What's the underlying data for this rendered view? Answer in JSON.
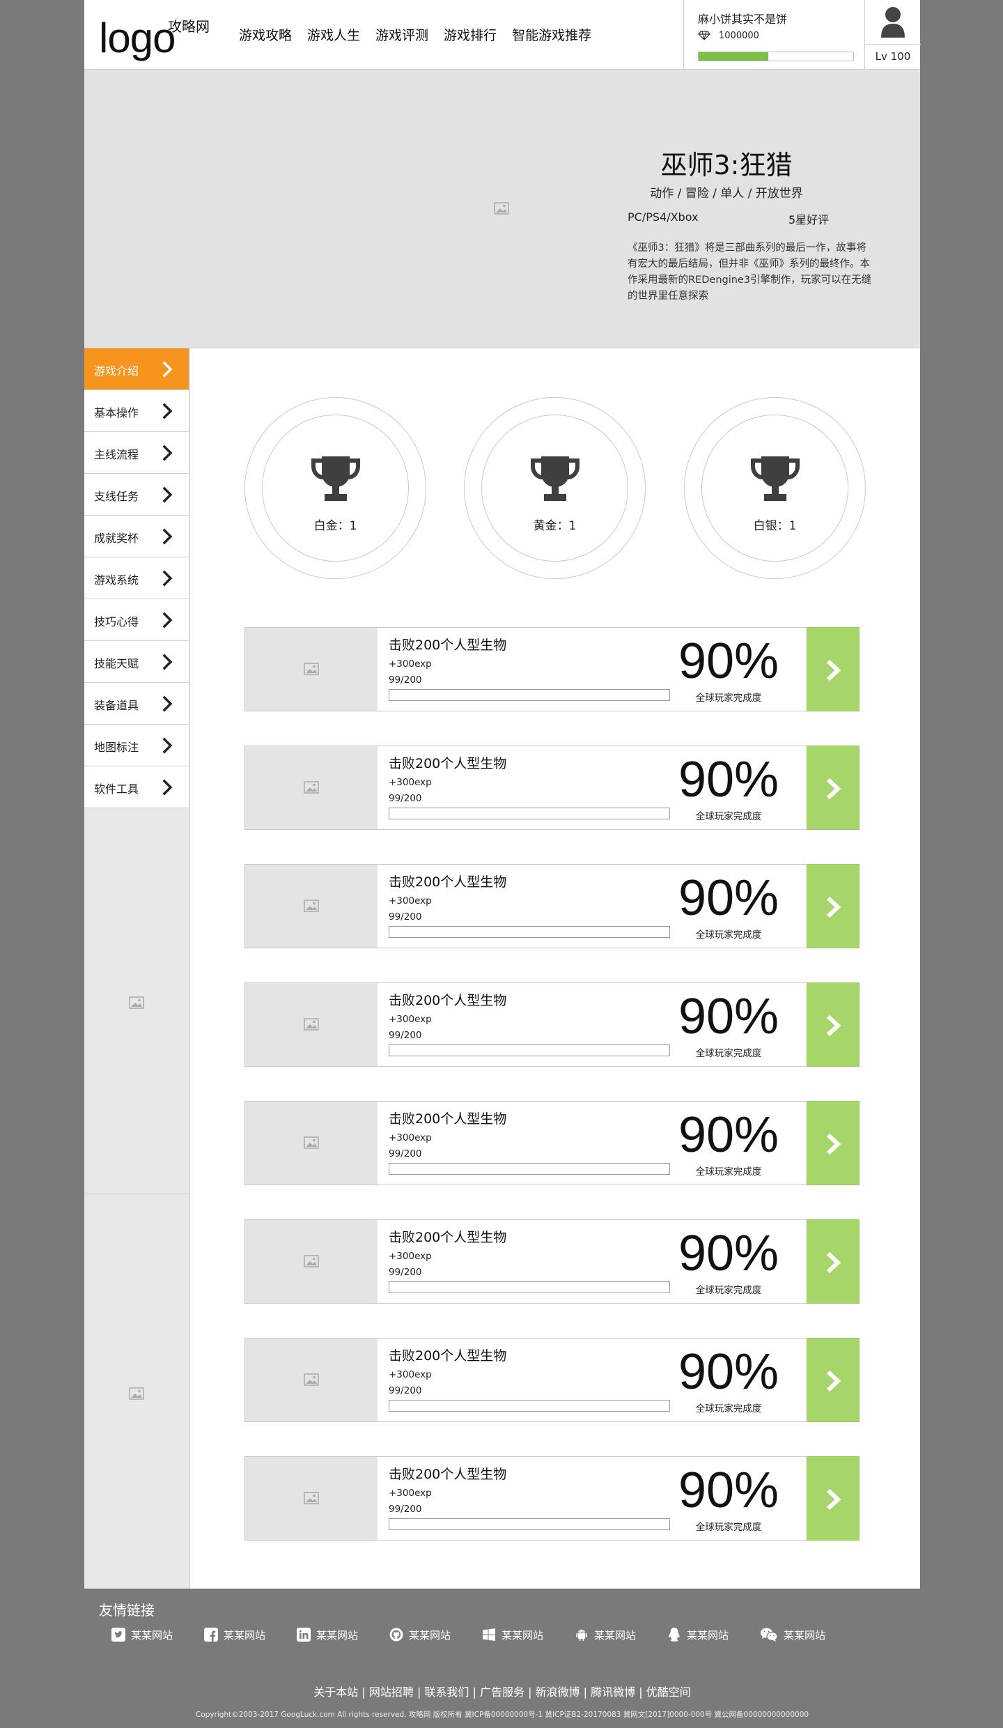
{
  "header": {
    "logo": "logo",
    "site_name": "攻略网",
    "nav": [
      "游戏攻略",
      "游戏人生",
      "游戏评测",
      "游戏排行",
      "智能游戏推荐"
    ],
    "user": {
      "name": "麻小饼其实不是饼",
      "gems": "1000000",
      "xp_progress": 0.45,
      "level": "Lv 100"
    }
  },
  "game": {
    "title": "巫师3:狂猎",
    "genres": "动作 / 冒险 / 单人 / 开放世界",
    "platforms": "PC/PS4/Xbox",
    "rating": "5星好评",
    "description": "《巫师3：狂猎》将是三部曲系列的最后一作，故事将有宏大的最后结局，但并非《巫师》系列的最终作。本作采用最新的REDengine3引擎制作，玩家可以在无缝的世界里任意探索"
  },
  "sidebar": {
    "items": [
      "游戏介绍",
      "基本操作",
      "主线流程",
      "支线任务",
      "成就奖杯",
      "游戏系统",
      "技巧心得",
      "技能天赋",
      "装备道具",
      "地图标注",
      "软件工具"
    ],
    "active_index": 0
  },
  "trophies": [
    {
      "label": "白金：1"
    },
    {
      "label": "黄金：1"
    },
    {
      "label": "白银：1"
    }
  ],
  "achievements": [
    {
      "title": "击败200个人型生物",
      "exp": "+300exp",
      "count": "99/200",
      "progress": 0,
      "percent": "90%",
      "percent_label": "全球玩家完成度"
    },
    {
      "title": "击败200个人型生物",
      "exp": "+300exp",
      "count": "99/200",
      "progress": 0,
      "percent": "90%",
      "percent_label": "全球玩家完成度"
    },
    {
      "title": "击败200个人型生物",
      "exp": "+300exp",
      "count": "99/200",
      "progress": 0,
      "percent": "90%",
      "percent_label": "全球玩家完成度"
    },
    {
      "title": "击败200个人型生物",
      "exp": "+300exp",
      "count": "99/200",
      "progress": 0,
      "percent": "90%",
      "percent_label": "全球玩家完成度"
    },
    {
      "title": "击败200个人型生物",
      "exp": "+300exp",
      "count": "99/200",
      "progress": 0,
      "percent": "90%",
      "percent_label": "全球玩家完成度"
    },
    {
      "title": "击败200个人型生物",
      "exp": "+300exp",
      "count": "99/200",
      "progress": 0,
      "percent": "90%",
      "percent_label": "全球玩家完成度"
    },
    {
      "title": "击败200个人型生物",
      "exp": "+300exp",
      "count": "99/200",
      "progress": 0,
      "percent": "90%",
      "percent_label": "全球玩家完成度"
    },
    {
      "title": "击败200个人型生物",
      "exp": "+300exp",
      "count": "99/200",
      "progress": 0,
      "percent": "90%",
      "percent_label": "全球玩家完成度"
    }
  ],
  "footer": {
    "title": "友情链接",
    "links": [
      {
        "icon": "twitter-icon",
        "label": "某某网站"
      },
      {
        "icon": "facebook-icon",
        "label": "某某网站"
      },
      {
        "icon": "linkedin-icon",
        "label": "某某网站"
      },
      {
        "icon": "github-icon",
        "label": "某某网站"
      },
      {
        "icon": "windows-icon",
        "label": "某某网站"
      },
      {
        "icon": "android-icon",
        "label": "某某网站"
      },
      {
        "icon": "qq-icon",
        "label": "某某网站"
      },
      {
        "icon": "wechat-icon",
        "label": "某某网站"
      }
    ],
    "nav": "关于本站 | 网站招聘 | 联系我们 | 广告服务 | 新浪微博 | 腾讯微博 | 优酷空间",
    "copyright": "Copyright©2003-2017 GoogLuck.com All rights reserved. 攻略网 版权所有 冀ICP备00000000号-1 冀ICP证B2-20170083 冀网文[2017]0000-000号 冀公网备00000000000000"
  },
  "colors": {
    "page_bg": "#7a7a7a",
    "accent_orange": "#f7941d",
    "accent_green": "#a6d66a",
    "progress_green": "#79c142",
    "placeholder_gray": "#e2e2e2"
  }
}
